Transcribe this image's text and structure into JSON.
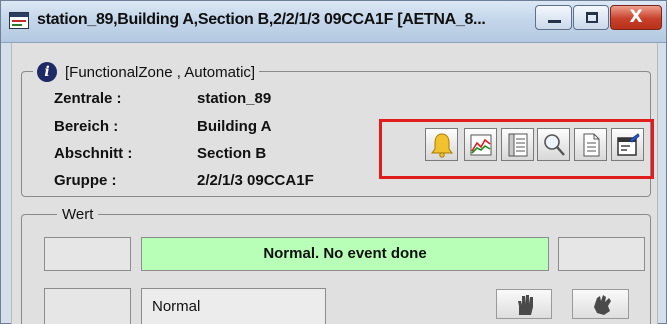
{
  "window": {
    "title": "station_89,Building A,Section B,2/2/1/3 09CCA1F [AETNA_8...",
    "controls": {
      "minimize": "minimize",
      "maximize": "maximize",
      "close": "X"
    }
  },
  "info": {
    "legend": "[FunctionalZone , Automatic]",
    "fields": [
      {
        "label": "Zentrale :",
        "value": "station_89"
      },
      {
        "label": "Bereich :",
        "value": "Building A"
      },
      {
        "label": "Abschnitt :",
        "value": "Section B"
      },
      {
        "label": "Gruppe :",
        "value": "2/2/1/3 09CCA1F"
      }
    ]
  },
  "toolbar": {
    "highlight_color": "#e01c1c",
    "buttons": [
      {
        "icon": "bell-icon"
      },
      {
        "icon": "chart-icon"
      },
      {
        "icon": "log-book-icon"
      },
      {
        "icon": "magnifier-icon"
      },
      {
        "icon": "document-icon"
      },
      {
        "icon": "properties-icon"
      }
    ]
  },
  "wert": {
    "legend": "Wert",
    "status_text": "Normal. No event done",
    "status_color": "#b8ffb8",
    "state": "Normal",
    "action_buttons": [
      {
        "icon": "hand-disable-icon"
      },
      {
        "icon": "hand-enable-icon"
      }
    ]
  }
}
